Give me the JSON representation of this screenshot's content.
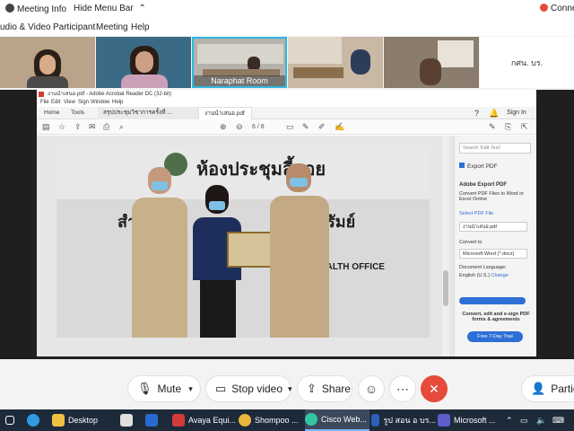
{
  "topbar": {
    "meeting_info": "Meeting Info",
    "hide_menu_bar": "Hide Menu Bar",
    "connection": "Conne"
  },
  "menubar": {
    "audio_video": "udio & Video",
    "participant": "Participant",
    "meeting": "Meeting",
    "help": "Help"
  },
  "videos": {
    "room_name": "Naraphat Room",
    "last_tile_label": "กศน. บร."
  },
  "acrobat": {
    "title": "งานนำเสนอ.pdf - Adobe Acrobat Reader DC (32-bit)",
    "menu": [
      "File",
      "Edit",
      "View",
      "Sign",
      "Window",
      "Help"
    ],
    "tabs": [
      "Home",
      "Tools",
      "สรุปประชุมวิชาการครั้งที่ ...",
      "งานนำเสนอ.pdf"
    ],
    "sign_in": "Sign In",
    "page_current": "6",
    "page_total": "/ 8",
    "photo_sign_line1": "ห้องประชุมลี้ลอย",
    "photo_sign_line2_left": "สำ",
    "photo_sign_line2_right": "บุรีรัมย์",
    "photo_sign_en": "L HEALTH OFFICE",
    "right_pane": {
      "search_placeholder": "Search 'Edit Text'",
      "export_pdf": "Export PDF",
      "adobe_export": "Adobe Export PDF",
      "desc": "Convert PDF Files to Word or Excel Online",
      "select_file": "Select PDF File",
      "file_name": "งานนำเสนอ.pdf",
      "convert_to": "Convert to",
      "format": "Microsoft Word (*.docx)",
      "doc_lang": "Document Language:",
      "lang_value": "English (U.S.)",
      "change": "Change",
      "promo": "Convert, edit and e-sign PDF forms & agreements",
      "trial": "Free 7-Day Trial"
    }
  },
  "controls": {
    "mute": "Mute",
    "stop_video": "Stop video",
    "share": "Share",
    "participants": "Participa"
  },
  "taskbar": {
    "items": [
      "Desktop",
      "Avaya Equi...",
      "Shompoo ...",
      "Cisco Web...",
      "รูป สอน อ บร...",
      "Microsoft ..."
    ]
  },
  "colors": {
    "accent_red": "#e64a3a",
    "acrobat_red": "#d63b2f",
    "acrobat_blue": "#2d6fd6",
    "taskbar": "#1c2a3a"
  }
}
